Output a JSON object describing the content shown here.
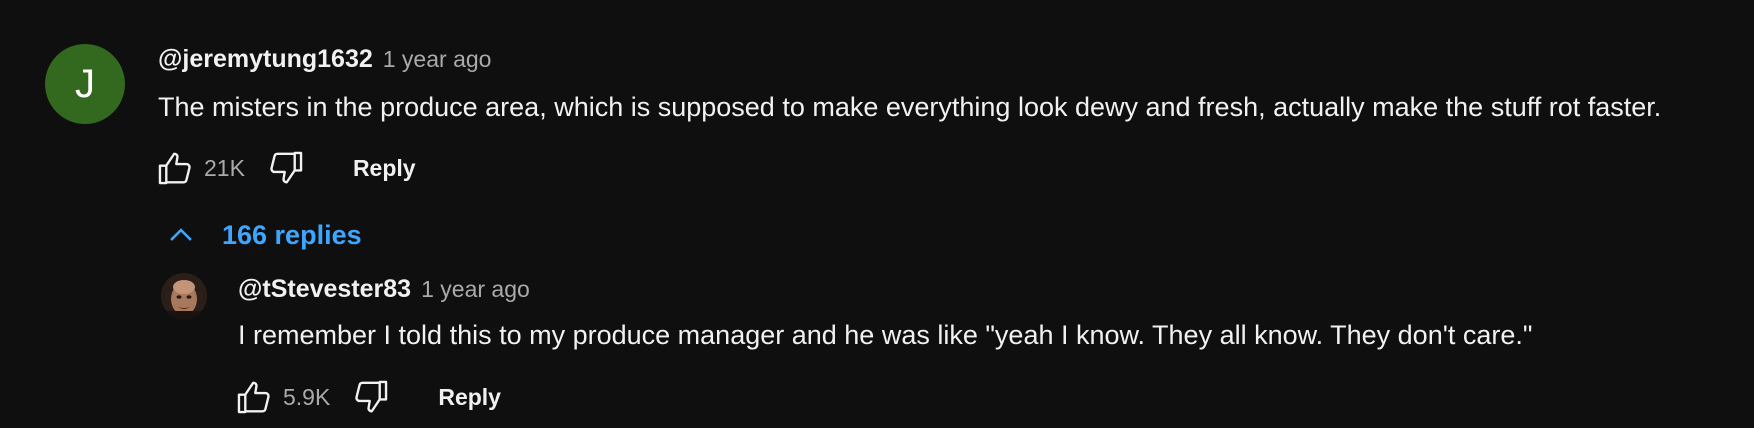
{
  "comment": {
    "avatar_letter": "J",
    "author": "@jeremytung1632",
    "time": "1 year ago",
    "text": "The misters in the produce area, which is supposed to make everything look dewy and fresh, actually make the stuff rot faster.",
    "likes": "21K",
    "reply_label": "Reply",
    "replies_label": "166 replies"
  },
  "reply": {
    "author": "@tStevester83",
    "time": "1 year ago",
    "text": "I remember I told this to my produce manager and he was like \"yeah I know. They all know. They don't care.\"",
    "likes": "5.9K",
    "reply_label": "Reply"
  },
  "colors": {
    "background": "#0f0f0f",
    "text": "#f1f1f1",
    "secondary": "#aaaaaa",
    "link": "#3ea6ff",
    "avatar": "#33691e"
  },
  "icons": {
    "like": "thumbs-up-icon",
    "dislike": "thumbs-down-icon",
    "collapse": "chevron-up-icon"
  }
}
